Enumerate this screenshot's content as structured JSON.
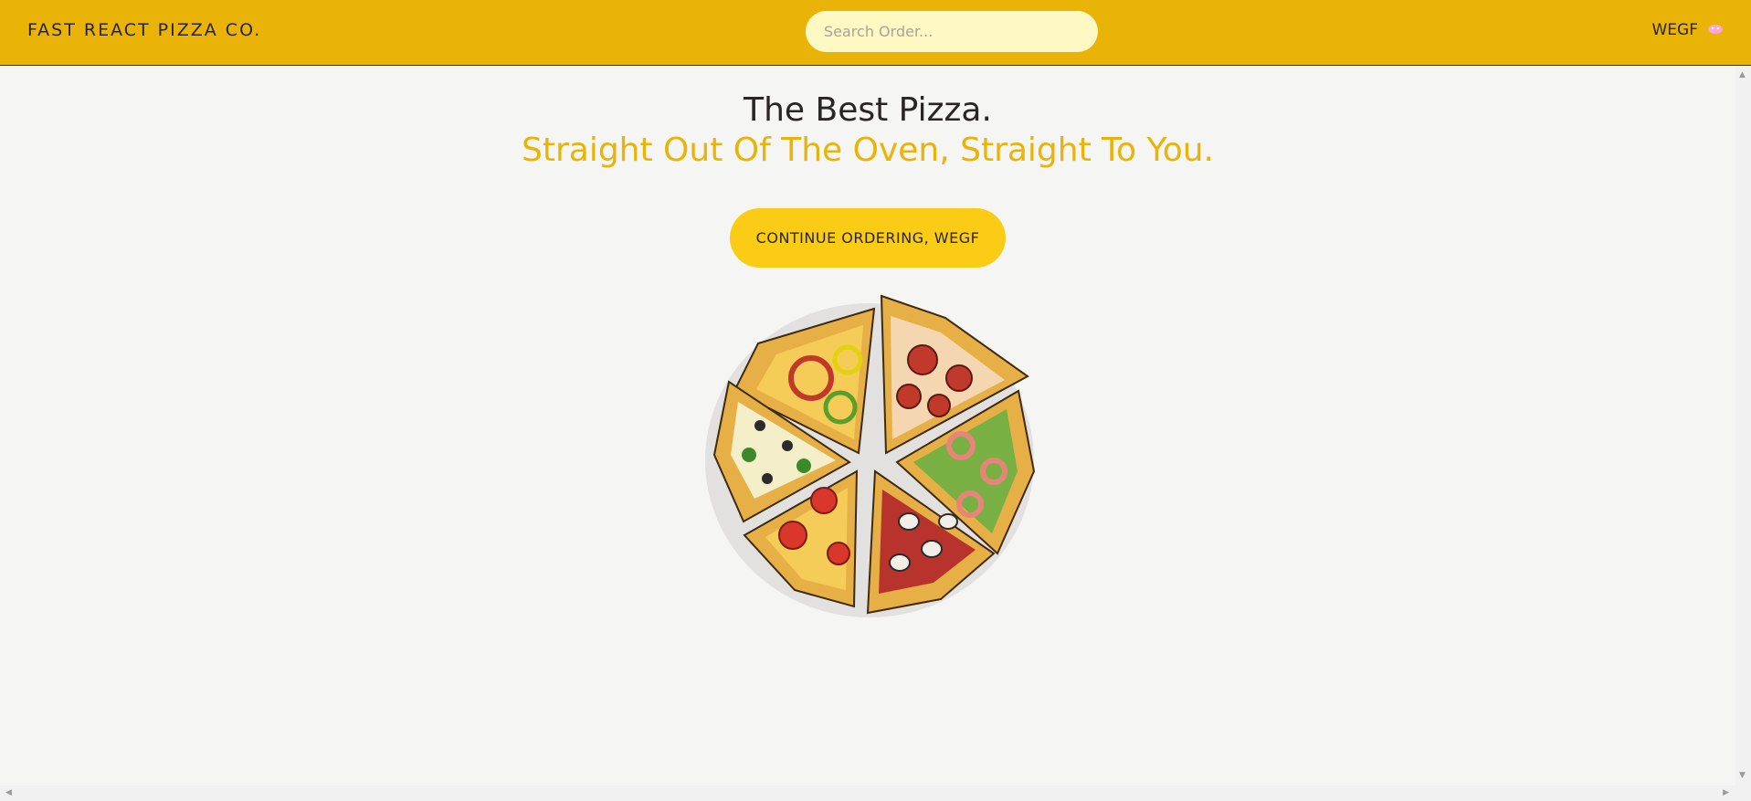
{
  "header": {
    "brand": "FAST REACT PIZZA CO.",
    "search_placeholder": "Search Order...",
    "username": "WEGF"
  },
  "hero": {
    "title": "The Best Pizza.",
    "subtitle": "Straight Out Of The Oven, Straight To You.",
    "cta_label": "CONTINUE ORDERING, WEGF"
  },
  "icons": {
    "user_icon": "user-badge-icon",
    "hero_image": "pizza-illustration"
  },
  "colors": {
    "header_bg": "#eab308",
    "search_bg": "#fef9c3",
    "accent": "#eab308",
    "button_bg": "#facc15",
    "page_bg": "#f5f5f4"
  }
}
